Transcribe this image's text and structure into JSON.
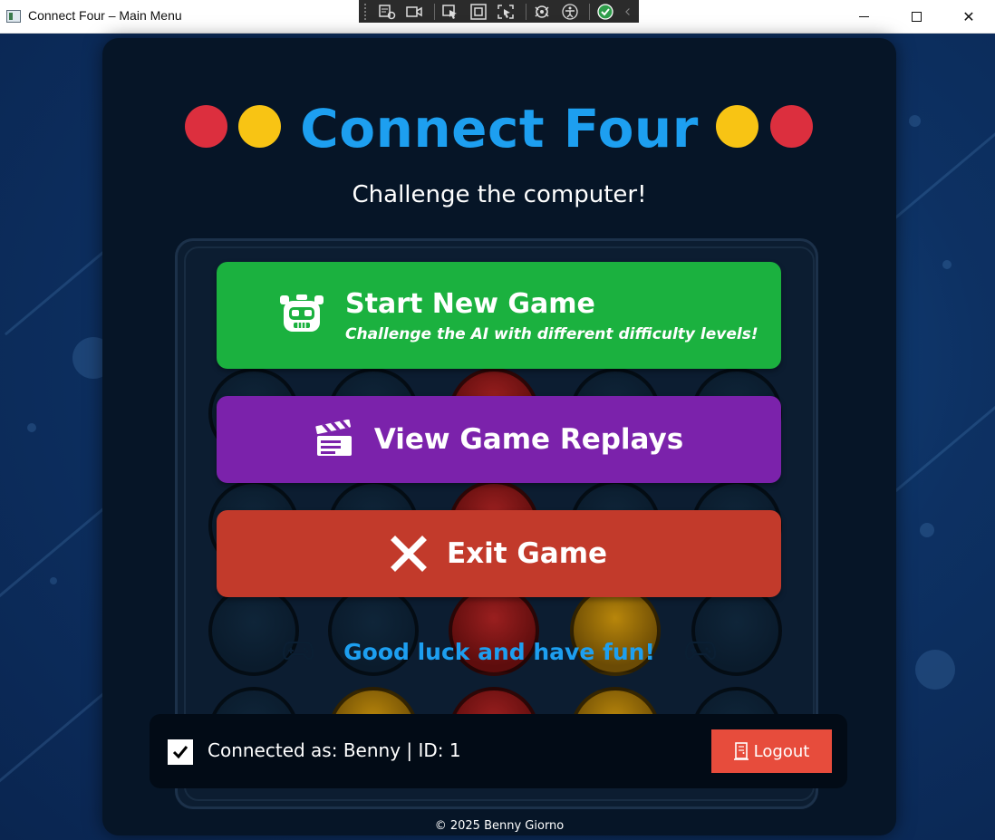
{
  "window": {
    "title": "Connect Four – Main Menu",
    "minimize_glyph": "",
    "close_glyph": "✕"
  },
  "debug_toolbar": {
    "icons": [
      "visual-tree-icon",
      "record-icon",
      "select-element-icon",
      "display-layout-adorners-icon",
      "track-focus-icon",
      "hot-reload-icon",
      "accessibility-icon",
      "binding-failures-ok-icon",
      "collapse-icon"
    ]
  },
  "header": {
    "logo_text": "Connect Four",
    "subtitle": "Challenge the computer!",
    "dot_colors": [
      "#dc2f3e",
      "#f8c414"
    ]
  },
  "menu": {
    "start": {
      "label": "Start New Game",
      "sublabel": "Challenge the AI with different difficulty levels!",
      "icon": "robot-icon",
      "color": "#1bb13f"
    },
    "replays": {
      "label": "View Game Replays",
      "icon": "clapperboard-icon",
      "color": "#7b22ab"
    },
    "exit": {
      "label": "Exit Game",
      "icon": "x-icon",
      "color": "#c23a2b"
    }
  },
  "tagline": {
    "text": "Good luck and have fun!",
    "icon": "gamepad-icon"
  },
  "footer": {
    "checkbox_checked": true,
    "connected_text": "Connected as: Benny | ID: 1",
    "logout_label": "Logout",
    "logout_icon": "door-icon",
    "logout_color": "#e74c3c"
  },
  "copyright": "© 2025  Benny Giorno"
}
